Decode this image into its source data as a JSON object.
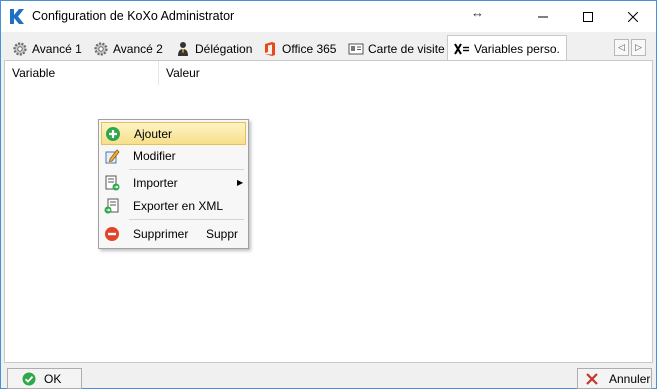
{
  "window": {
    "title": "Configuration de KoXo Administrator",
    "resize_glyph": "↔"
  },
  "tabs": [
    {
      "label": "Avancé 1",
      "icon": "gear-icon"
    },
    {
      "label": "Avancé 2",
      "icon": "gear-icon"
    },
    {
      "label": "Délégation",
      "icon": "delegate-user-icon"
    },
    {
      "label": "Office 365",
      "icon": "office365-icon"
    },
    {
      "label": "Carte de visite",
      "icon": "business-card-icon"
    },
    {
      "label": "Variables perso.",
      "icon": "variables-icon",
      "active": true
    }
  ],
  "tab_scroll": {
    "left": "◁",
    "right": "▷"
  },
  "table": {
    "columns": [
      "Variable",
      "Valeur"
    ],
    "rows": []
  },
  "context_menu": {
    "items": [
      {
        "label": "Ajouter",
        "icon": "add-icon",
        "highlighted": true
      },
      {
        "label": "Modifier",
        "icon": "edit-icon"
      },
      {
        "label": "Importer",
        "icon": "import-icon",
        "submenu": "▶"
      },
      {
        "label": "Exporter en XML",
        "icon": "export-xml-icon"
      },
      {
        "label": "Supprimer",
        "icon": "delete-icon",
        "shortcut": "Suppr"
      }
    ]
  },
  "footer": {
    "ok_label": "OK",
    "cancel_label": "Annuler"
  },
  "colors": {
    "accent": "#1f6fc4",
    "window_border": "#4a90d9",
    "highlight": "#f7e08b",
    "ok_green": "#2ea84a",
    "cancel_red": "#c0392b"
  }
}
